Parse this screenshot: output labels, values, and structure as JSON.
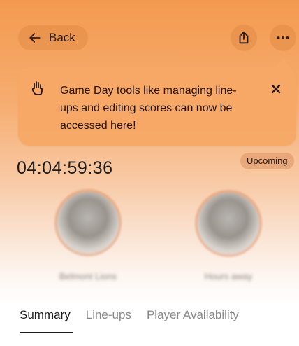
{
  "header": {
    "back_label": "Back",
    "back_icon": "arrow-left-icon",
    "share_icon": "share-icon",
    "more_icon": "more-horizontal-icon"
  },
  "banner": {
    "icon": "hand-icon",
    "message": "Game Day tools like managing line-ups and editing scores can now be accessed here!",
    "close_icon": "close-icon"
  },
  "match": {
    "countdown": "04:04:59:36",
    "status": "Upcoming",
    "home_team": "Belmont Lions",
    "away_team": "Hours away"
  },
  "tabs": [
    {
      "label": "Summary",
      "active": true
    },
    {
      "label": "Line-ups",
      "active": false
    },
    {
      "label": "Player Availability",
      "active": false
    }
  ],
  "colors": {
    "accent": "#f39a4f",
    "banner": "#f7a866"
  }
}
